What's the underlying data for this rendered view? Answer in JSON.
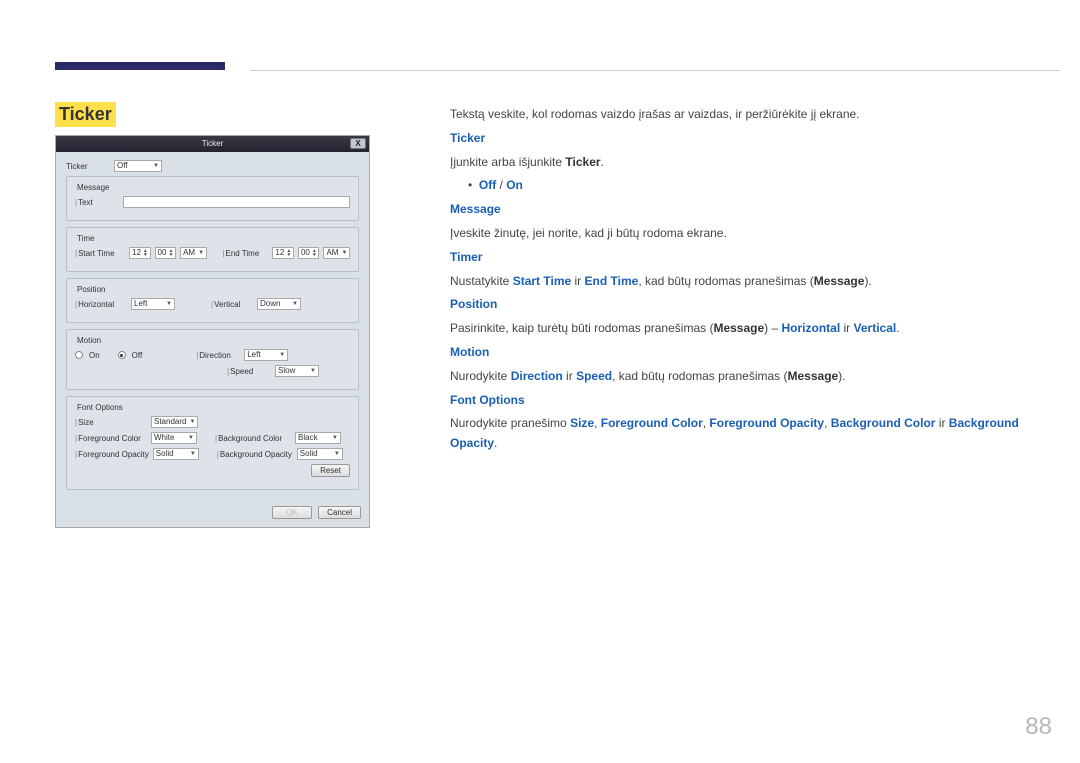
{
  "page": {
    "number": "88",
    "section_title": "Ticker"
  },
  "dialog": {
    "title": "Ticker",
    "close": "X",
    "ticker_label": "Ticker",
    "ticker_value": "Off",
    "message_label": "Message",
    "message_field_label": "Text",
    "message_value": "",
    "time_label": "Time",
    "start_time_label": "Start Time",
    "start_hh": "12",
    "start_mm": "00",
    "start_ampm": "AM",
    "end_time_label": "End Time",
    "end_hh": "12",
    "end_mm": "00",
    "end_ampm": "AM",
    "position_label": "Position",
    "horizontal_label": "Horizontal",
    "horizontal_value": "Left",
    "vertical_label": "Vertical",
    "vertical_value": "Down",
    "motion_label": "Motion",
    "motion_on": "On",
    "motion_off": "Off",
    "direction_label": "Direction",
    "direction_value": "Left",
    "speed_label": "Speed",
    "speed_value": "Slow",
    "font_options_label": "Font Options",
    "size_label": "Size",
    "size_value": "Standard",
    "fg_color_label": "Foreground Color",
    "fg_color_value": "White",
    "bg_color_label": "Background Color",
    "bg_color_value": "Black",
    "fg_opacity_label": "Foreground Opacity",
    "fg_opacity_value": "Solid",
    "bg_opacity_label": "Background Opacity",
    "bg_opacity_value": "Solid",
    "reset": "Reset",
    "ok": "OK",
    "cancel": "Cancel"
  },
  "doc": {
    "intro": "Tekstą veskite, kol rodomas vaizdo įrašas ar vaizdas, ir peržiūrėkite jį ekrane.",
    "h_ticker": "Ticker",
    "ticker_text1": "Įjunkite arba išjunkite ",
    "ticker_bold": "Ticker",
    "off": "Off",
    "on": "On",
    "h_message": "Message",
    "message_text": "Įveskite žinutę, jei norite, kad ji būtų rodoma ekrane.",
    "h_timer": "Timer",
    "timer_pre": "Nustatykite ",
    "timer_start": "Start Time",
    "timer_and": " ir ",
    "timer_end": "End Time",
    "timer_post": ", kad būtų rodomas pranešimas (",
    "timer_msg": "Message",
    "timer_close": ").",
    "h_position": "Position",
    "pos_pre": "Pasirinkite, kaip turėtų būti rodomas pranešimas (",
    "pos_msg": "Message",
    "pos_mid": ") – ",
    "pos_h": "Horizontal",
    "pos_and": " ir ",
    "pos_v": "Vertical",
    "h_motion": "Motion",
    "mot_pre": "Nurodykite ",
    "mot_dir": "Direction",
    "mot_and": " ir ",
    "mot_speed": "Speed",
    "mot_post": ", kad būtų rodomas pranešimas (",
    "mot_msg": "Message",
    "mot_close": ").",
    "h_font": "Font Options",
    "font_pre": "Nurodykite pranešimo ",
    "font_size": "Size",
    "font_fgc": "Foreground Color",
    "font_fgo": "Foreground Opacity",
    "font_bgc": "Background Color",
    "font_and": " ir ",
    "font_bgo": "Background Opacity",
    "sep": ", ",
    "period": "."
  }
}
